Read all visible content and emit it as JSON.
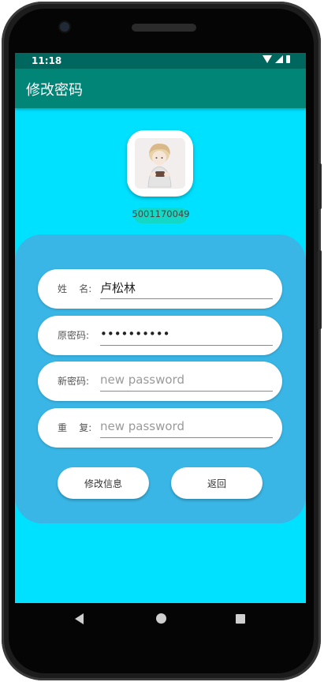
{
  "status_bar": {
    "time": "11:18",
    "icons": [
      "wifi-icon",
      "signal-icon",
      "battery-icon"
    ]
  },
  "app_bar": {
    "title": "修改密码"
  },
  "profile": {
    "user_id": "5001170049"
  },
  "form": {
    "name": {
      "label": "姓    名:",
      "value": "卢松林"
    },
    "old_password": {
      "label": "原密码:",
      "value": "••••••••••"
    },
    "new_password": {
      "label": "新密码:",
      "placeholder": "new password"
    },
    "repeat_password": {
      "label": "重    复:",
      "placeholder": "new password"
    }
  },
  "buttons": {
    "modify_label": "修改信息",
    "back_label": "返回"
  },
  "colors": {
    "screen_bg": "#00e1ff",
    "app_bar": "#008577",
    "status_bar": "#00675e",
    "card": "#39b6e6",
    "id_pill": "#14d8c6"
  }
}
